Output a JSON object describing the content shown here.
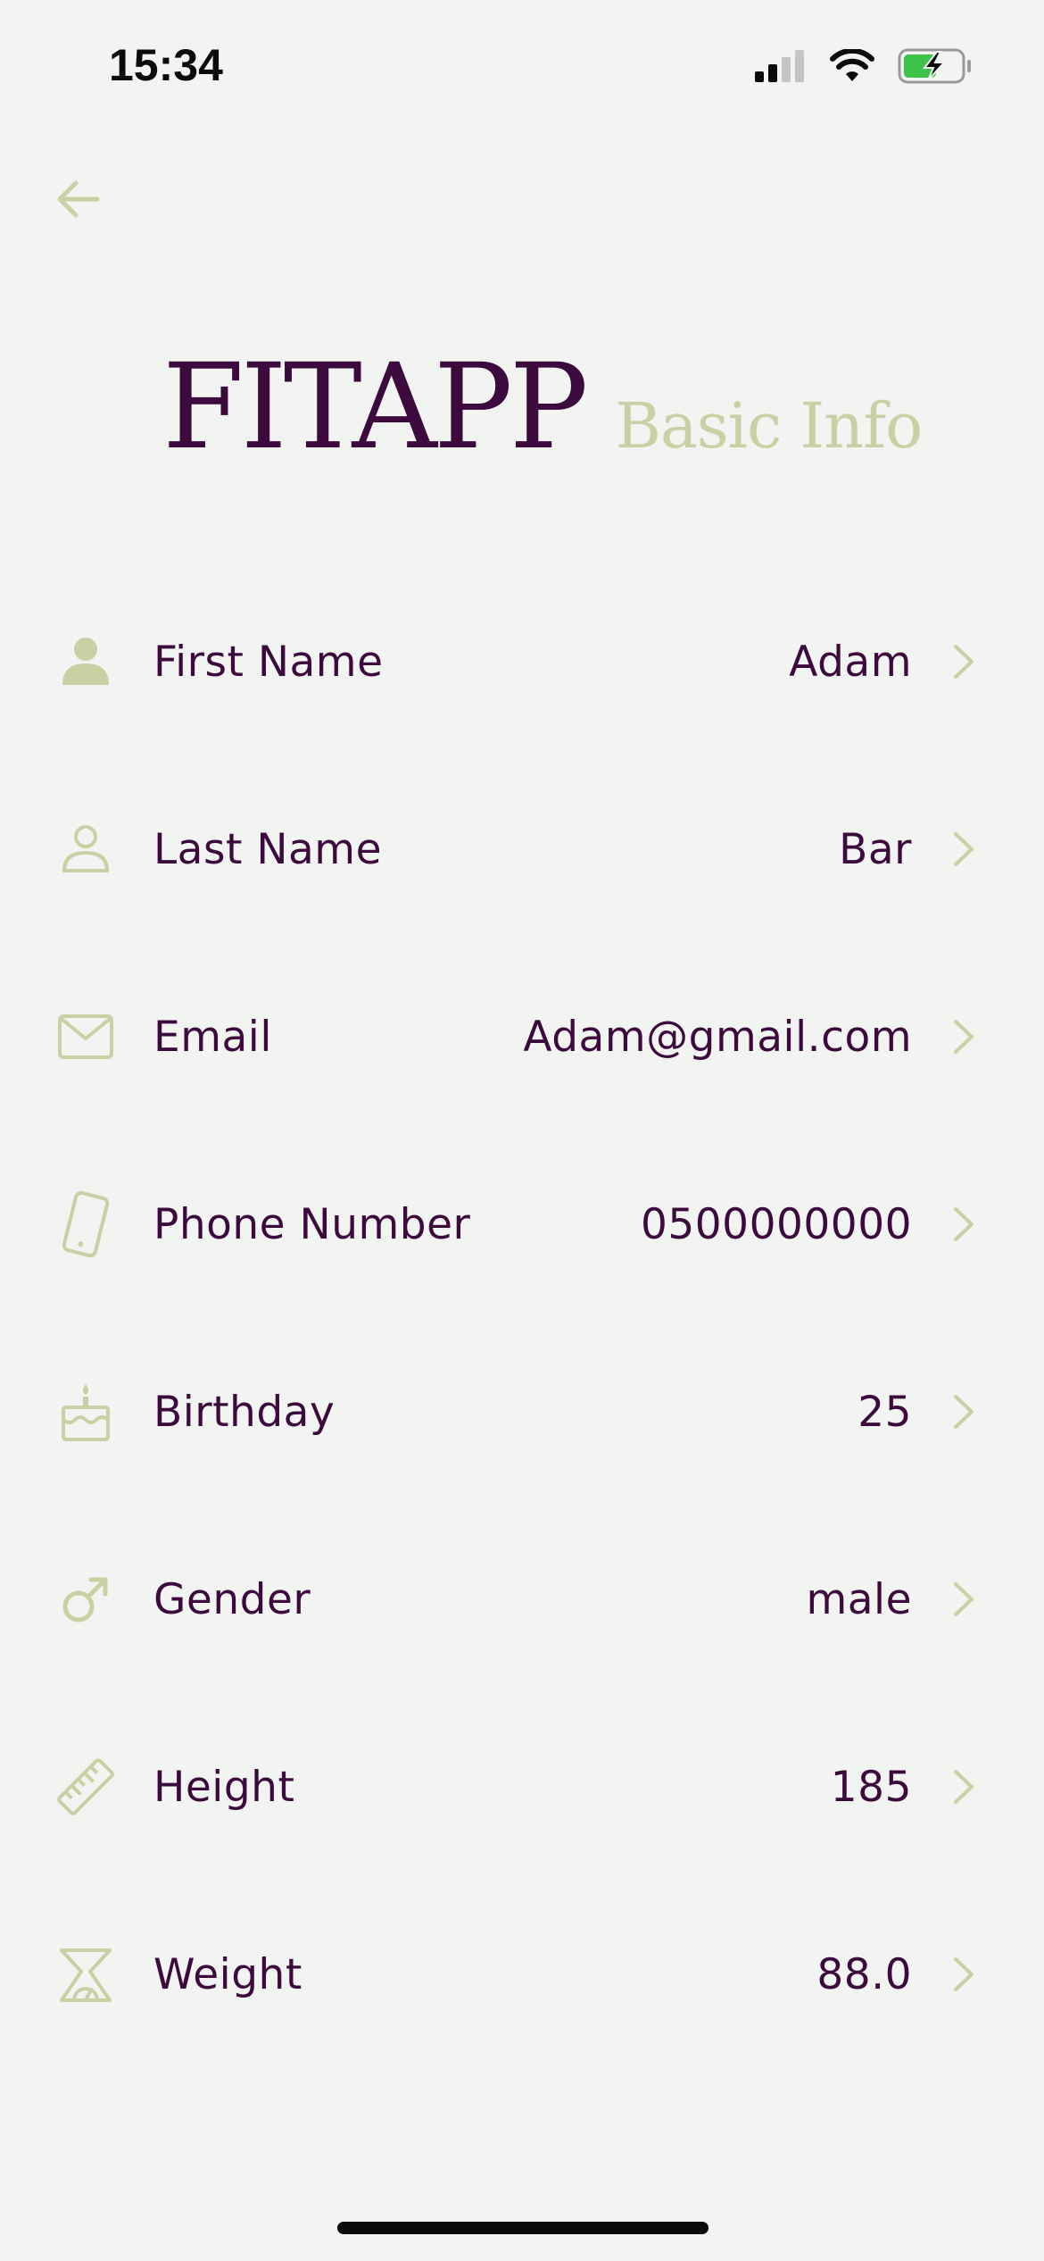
{
  "status_bar": {
    "time": "15:34",
    "icons": [
      "signal-icon",
      "wifi-icon",
      "battery-charging-icon"
    ],
    "battery_color": "#3ec24a"
  },
  "header": {
    "back_icon": "arrow-left-icon",
    "brand_title": "FITAPP",
    "page_subtitle": "Basic Info"
  },
  "colors": {
    "primary": "#3d0a3d",
    "accent": "#c9d1a4",
    "background": "#f2f4f2"
  },
  "rows": [
    {
      "icon": "person-icon",
      "label": "First Name",
      "value": "Adam"
    },
    {
      "icon": "person-outline-icon",
      "label": "Last Name",
      "value": "Bar"
    },
    {
      "icon": "mail-icon",
      "label": "Email",
      "value": "Adam@gmail.com"
    },
    {
      "icon": "phone-icon",
      "label": "Phone Number",
      "value": "0500000000"
    },
    {
      "icon": "cake-icon",
      "label": "Birthday",
      "value": "25"
    },
    {
      "icon": "male-gender-icon",
      "label": "Gender",
      "value": "male"
    },
    {
      "icon": "ruler-icon",
      "label": "Height",
      "value": "185"
    },
    {
      "icon": "scale-icon",
      "label": "Weight",
      "value": "88.0"
    }
  ]
}
